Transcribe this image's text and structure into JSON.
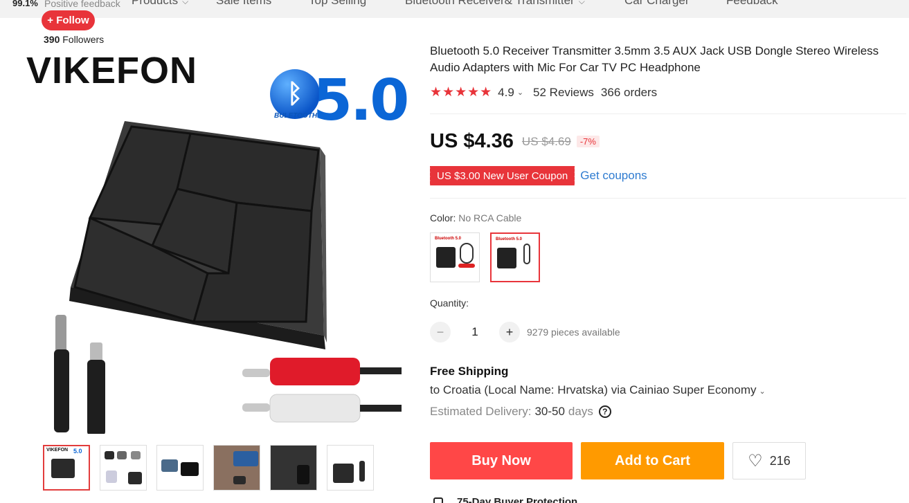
{
  "store": {
    "positive_feedback_pct": "99.1%",
    "positive_feedback_label": "Positive feedback",
    "follow_label": "+ Follow",
    "followers_count": "390",
    "followers_label": "Followers",
    "nav": [
      "Products",
      "Sale Items",
      "Top Selling",
      "Bluetooth Receiver& Transmitter",
      "Car Charger",
      "Feedback"
    ]
  },
  "image": {
    "brand": "VIKEFON",
    "bt_version": "5.0",
    "bt_word": "BULETOOTH",
    "thumb_brand": "VIKEFON",
    "thumb_version": "5.0"
  },
  "product": {
    "title": "Bluetooth 5.0 Receiver Transmitter 3.5mm 3.5 AUX Jack USB Dongle Stereo Wireless Audio Adapters with Mic For Car TV PC Headphone",
    "stars": "★★★★★",
    "rating": "4.9",
    "reviews": "52 Reviews",
    "orders": "366 orders",
    "price": "US $4.36",
    "old_price": "US $4.69",
    "discount": "-7%",
    "coupon": "US $3.00 New User Coupon",
    "get_coupons": "Get coupons",
    "color_label": "Color:",
    "color_value": "No RCA Cable",
    "swatch_title": "Bluetooth 5.0",
    "quantity_label": "Quantity:",
    "quantity": "1",
    "available": "9279 pieces available",
    "shipping_title": "Free Shipping",
    "shipping_to": "to Croatia (Local Name: Hrvatska) via Cainiao Super Economy",
    "delivery_label": "Estimated Delivery:",
    "delivery_days": "30-50",
    "delivery_unit": "days",
    "buy_now": "Buy Now",
    "add_to_cart": "Add to Cart",
    "wishlist_count": "216",
    "protection": "75-Day Buyer Protection"
  },
  "colors": {
    "accent": "#ff4747",
    "cart": "#ff9a00",
    "link": "#2e7bd0"
  }
}
